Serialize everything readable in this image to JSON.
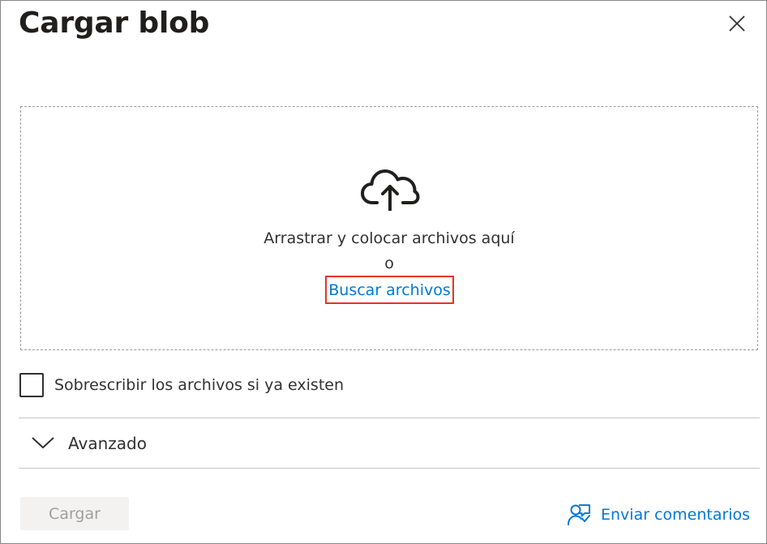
{
  "dialog": {
    "title": "Cargar blob",
    "close_icon": "close-icon"
  },
  "dropzone": {
    "icon": "cloud-upload-icon",
    "instruction": "Arrastrar y colocar archivos aquí",
    "separator": "o",
    "browse_label": "Buscar archivos",
    "highlight_color": "#e8341c"
  },
  "options": {
    "overwrite_label": "Sobrescribir los archivos si ya existen",
    "overwrite_checked": false,
    "advanced_label": "Avanzado"
  },
  "footer": {
    "upload_label": "Cargar",
    "upload_disabled": true,
    "feedback_label": "Enviar comentarios",
    "feedback_icon": "feedback-icon"
  },
  "colors": {
    "link": "#0078d4",
    "text": "#323130",
    "disabled_bg": "#f3f2f1",
    "disabled_text": "#a19f9d"
  }
}
